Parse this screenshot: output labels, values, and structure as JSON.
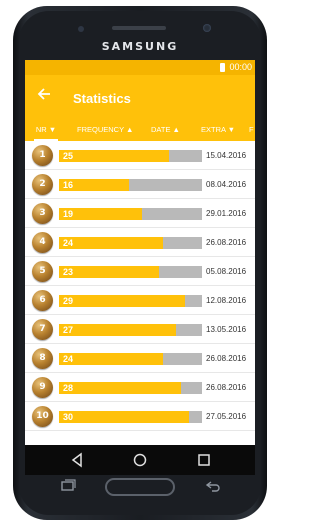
{
  "device": {
    "brand": "SAMSUNG"
  },
  "status_bar": {
    "time": "00:00",
    "color": "#f5b400"
  },
  "app_bar": {
    "title": "Statistics",
    "color": "#ffc10a"
  },
  "tabs": [
    {
      "label": "NR ▼",
      "active": true
    },
    {
      "label": "FREQUENCY ▲",
      "active": false
    },
    {
      "label": "DATE ▲",
      "active": false
    },
    {
      "label": "EXTRA ▼",
      "active": false
    },
    {
      "label": "F",
      "active": false
    }
  ],
  "rows": [
    {
      "nr": "1",
      "frequency": "25",
      "fill": 0.77,
      "date": "15.04.2016"
    },
    {
      "nr": "2",
      "frequency": "16",
      "fill": 0.49,
      "date": "08.04.2016"
    },
    {
      "nr": "3",
      "frequency": "19",
      "fill": 0.58,
      "date": "29.01.2016"
    },
    {
      "nr": "4",
      "frequency": "24",
      "fill": 0.73,
      "date": "26.08.2016"
    },
    {
      "nr": "5",
      "frequency": "23",
      "fill": 0.7,
      "date": "05.08.2016"
    },
    {
      "nr": "6",
      "frequency": "29",
      "fill": 0.88,
      "date": "12.08.2016"
    },
    {
      "nr": "7",
      "frequency": "27",
      "fill": 0.82,
      "date": "13.05.2016"
    },
    {
      "nr": "8",
      "frequency": "24",
      "fill": 0.73,
      "date": "26.08.2016"
    },
    {
      "nr": "9",
      "frequency": "28",
      "fill": 0.85,
      "date": "26.08.2016"
    },
    {
      "nr": "10",
      "frequency": "30",
      "fill": 0.91,
      "date": "27.05.2016"
    }
  ],
  "colors": {
    "accent": "#ffc10a",
    "bar_track": "#b9b9b9",
    "ball": "#b9822f"
  },
  "icons": {
    "back": "arrow-left-icon",
    "nav_back": "triangle-back-icon",
    "nav_home": "circle-home-icon",
    "nav_recents": "square-recents-icon"
  }
}
